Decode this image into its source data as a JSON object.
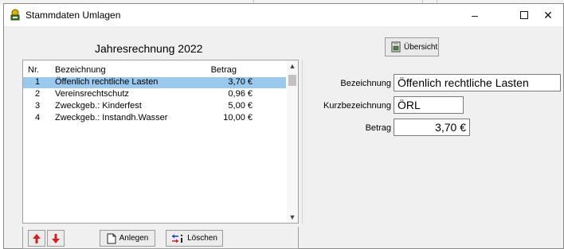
{
  "window": {
    "title": "Stammdaten Umlagen",
    "minimize_glyph": "–",
    "close_glyph": "✕"
  },
  "header": {
    "label": "Jahresrechnung 2022",
    "overview_button_label": "Übersicht"
  },
  "list": {
    "columns": {
      "nr": "Nr.",
      "bezeichnung": "Bezeichnung",
      "betrag": "Betrag"
    },
    "rows": [
      {
        "nr": "1",
        "bezeichnung": "Öffenlich rechtliche Lasten",
        "betrag": "3,70 €",
        "selected": true
      },
      {
        "nr": "2",
        "bezeichnung": "Vereinsrechtschutz",
        "betrag": "0,96 €",
        "selected": false
      },
      {
        "nr": "3",
        "bezeichnung": "Zweckgeb.: Kinderfest",
        "betrag": "5,00 €",
        "selected": false
      },
      {
        "nr": "4",
        "bezeichnung": "Zweckgeb.: Instandh.Wasser",
        "betrag": "10,00 €",
        "selected": false
      }
    ]
  },
  "detail": {
    "bezeichnung_label": "Bezeichnung",
    "bezeichnung_value": "Öffenlich rechtliche Lasten",
    "kurz_label": "Kurzbezeichnung",
    "kurz_value": "ÖRL",
    "betrag_label": "Betrag",
    "betrag_value": "3,70 €"
  },
  "toolbar": {
    "anlegen_label": "Anlegen",
    "loeschen_label": "Löschen"
  },
  "icons": {
    "app": "badge-icon",
    "overview": "overview-icon",
    "up": "arrow-up-icon",
    "down": "arrow-down-icon",
    "new": "new-document-icon",
    "delete": "delete-icon"
  },
  "colors": {
    "selection": "#99c9ef",
    "arrow_red": "#d62020"
  }
}
